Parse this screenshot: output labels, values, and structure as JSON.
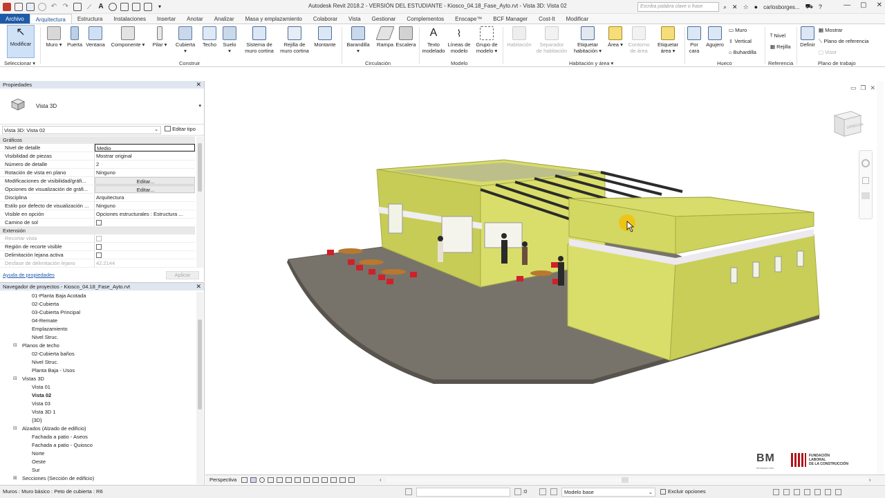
{
  "title_bar": {
    "title": "Autodesk Revit 2018.2 - VERSIÓN DEL ESTUDIANTE -   Kiosco_04.18_Fase_Ayto.rvt - Vista 3D: Vista 02",
    "search_placeholder": "Escriba palabra clave o frase",
    "user": "carlosborges..."
  },
  "tabs": [
    "Archivo",
    "Arquitectura",
    "Estructura",
    "Instalaciones",
    "Insertar",
    "Anotar",
    "Analizar",
    "Masa y emplazamiento",
    "Colaborar",
    "Vista",
    "Gestionar",
    "Complementos",
    "Enscape™",
    "BCF Manager",
    "Cost-It",
    "Modificar"
  ],
  "ribbon": {
    "modify": "Modificar",
    "select_panel": "Seleccionar",
    "construir": {
      "label": "Construir",
      "muro": "Muro",
      "puerta": "Puerta",
      "ventana": "Ventana",
      "componente": "Componente",
      "pilar": "Pilar",
      "cubierta": "Cubierta",
      "techo": "Techo",
      "suelo": "Suelo",
      "sistema_muro_1": "Sistema de",
      "sistema_muro_2": "muro cortina",
      "rejilla_1": "Rejilla de",
      "rejilla_2": "muro cortina",
      "montante": "Montante"
    },
    "circulacion": {
      "label": "Circulación",
      "barandilla": "Barandilla",
      "rampa": "Rampa",
      "escalera": "Escalera"
    },
    "modelo": {
      "label": "Modelo",
      "texto_1": "Texto",
      "texto_2": "modelado",
      "lineas_1": "Líneas de",
      "lineas_2": "modelo",
      "grupo_1": "Grupo de",
      "grupo_2": "modelo"
    },
    "habitacion": {
      "label": "Habitación y área",
      "hab": "Habitación",
      "sep_1": "Separador",
      "sep_2": "de habitación",
      "etq_1": "Etiquetar",
      "etq_2": "habitación",
      "area": "Área",
      "cont_1": "Contorno",
      "cont_2": "de área",
      "etqa_1": "Etiquetar",
      "etqa_2": "área"
    },
    "hueco": {
      "label": "Hueco",
      "por_1": "Por",
      "por_2": "cara",
      "agujero": "Agujero",
      "muro": "Muro",
      "vertical": "Vertical",
      "buhardilla": "Buhardilla"
    },
    "referencia": {
      "label": "Referencia",
      "nivel": "Nivel",
      "rejilla": "Rejilla"
    },
    "plano_trabajo": {
      "label": "Plano de trabajo",
      "definir": "Definir",
      "mostrar": "Mostrar",
      "plano_ref": "Plano de referencia",
      "visor": "Visor"
    }
  },
  "properties": {
    "title": "Propiedades",
    "type_name": "Vista 3D",
    "instance": "Vista 3D: Vista 02",
    "edit_type": "Editar tipo",
    "groups": {
      "graficos": "Gráficos",
      "extension": "Extensión"
    },
    "rows_graficos": [
      {
        "k": "Nivel de detalle",
        "v": "Medio"
      },
      {
        "k": "Visibilidad de piezas",
        "v": "Mostrar original"
      },
      {
        "k": "Número de detalle",
        "v": "2"
      },
      {
        "k": "Rotación de vista en plano",
        "v": "Ninguno"
      },
      {
        "k": "Modificaciones de visibilidad/gráfi...",
        "v": "Editar..."
      },
      {
        "k": "Opciones de visualización de gráfi...",
        "v": "Editar..."
      },
      {
        "k": "Disciplina",
        "v": "Arquitectura"
      },
      {
        "k": "Estilo por defecto de visualización ...",
        "v": "Ninguno"
      },
      {
        "k": "Visible en opción",
        "v": "Opciones estructurales : Estructura ..."
      },
      {
        "k": "Camino de sol",
        "v": ""
      }
    ],
    "rows_extension": [
      {
        "k": "Recortar vista",
        "v": ""
      },
      {
        "k": "Región de recorte visible",
        "v": ""
      },
      {
        "k": "Delimitación lejana activa",
        "v": ""
      },
      {
        "k": "Desfase de delimitación lejano",
        "v": "42.2144"
      }
    ],
    "help_link": "Ayuda de propiedades",
    "apply": "Aplicar"
  },
  "browser": {
    "title": "Navegador de proyectos - Kiosco_04.18_Fase_Ayto.rvt",
    "items": [
      {
        "t": "01-Planta Baja Acotada",
        "lvl": 2
      },
      {
        "t": "02-Cubierta",
        "lvl": 2
      },
      {
        "t": "03-Cubierta Principal",
        "lvl": 2
      },
      {
        "t": "04-Remate",
        "lvl": 2
      },
      {
        "t": "Emplazamiento",
        "lvl": 2
      },
      {
        "t": "Nivel Struc.",
        "lvl": 2
      },
      {
        "t": "Planos de techo",
        "lvl": 1,
        "toggle": "−"
      },
      {
        "t": "02-Cubierta baños",
        "lvl": 2
      },
      {
        "t": "Nivel Struc.",
        "lvl": 2
      },
      {
        "t": "Planta Baja - Usos",
        "lvl": 2
      },
      {
        "t": "Vistas 3D",
        "lvl": 1,
        "toggle": "−"
      },
      {
        "t": "Vista 01",
        "lvl": 2
      },
      {
        "t": "Vista 02",
        "lvl": 2,
        "bold": true
      },
      {
        "t": "Vista 03",
        "lvl": 2
      },
      {
        "t": "Vista 3D 1",
        "lvl": 2
      },
      {
        "t": "{3D}",
        "lvl": 2
      },
      {
        "t": "Alzados (Alzado de edificio)",
        "lvl": 1,
        "toggle": "−"
      },
      {
        "t": "Fachada a patio - Aseos",
        "lvl": 2
      },
      {
        "t": "Fachada a patio - Quiosco",
        "lvl": 2
      },
      {
        "t": "Norte",
        "lvl": 2
      },
      {
        "t": "Oeste",
        "lvl": 2
      },
      {
        "t": "Sur",
        "lvl": 2
      },
      {
        "t": "Secciones (Sección de edificio)",
        "lvl": 1,
        "toggle": "+"
      }
    ]
  },
  "canvas": {
    "viewcube_text": "DERECHA",
    "logo_1": "BM",
    "logo_1_sub": "formación bim",
    "logo_2_line1": "FUNDACIÓN",
    "logo_2_line2": "LABORAL",
    "logo_2_line3": "DE LA CONSTRUCCIÓN"
  },
  "view_control": {
    "mode": "Perspectiva"
  },
  "status": {
    "text": "Muros : Muro básico : Peto de cubierta : R6",
    "zoom": ":0",
    "model": "Modelo base",
    "exclude": "Excluir opciones"
  },
  "colors": {
    "accent": "#1e5aa8",
    "wall": "#d9de6a",
    "wall_dark": "#b9be4c",
    "ground": "#7a766e"
  }
}
